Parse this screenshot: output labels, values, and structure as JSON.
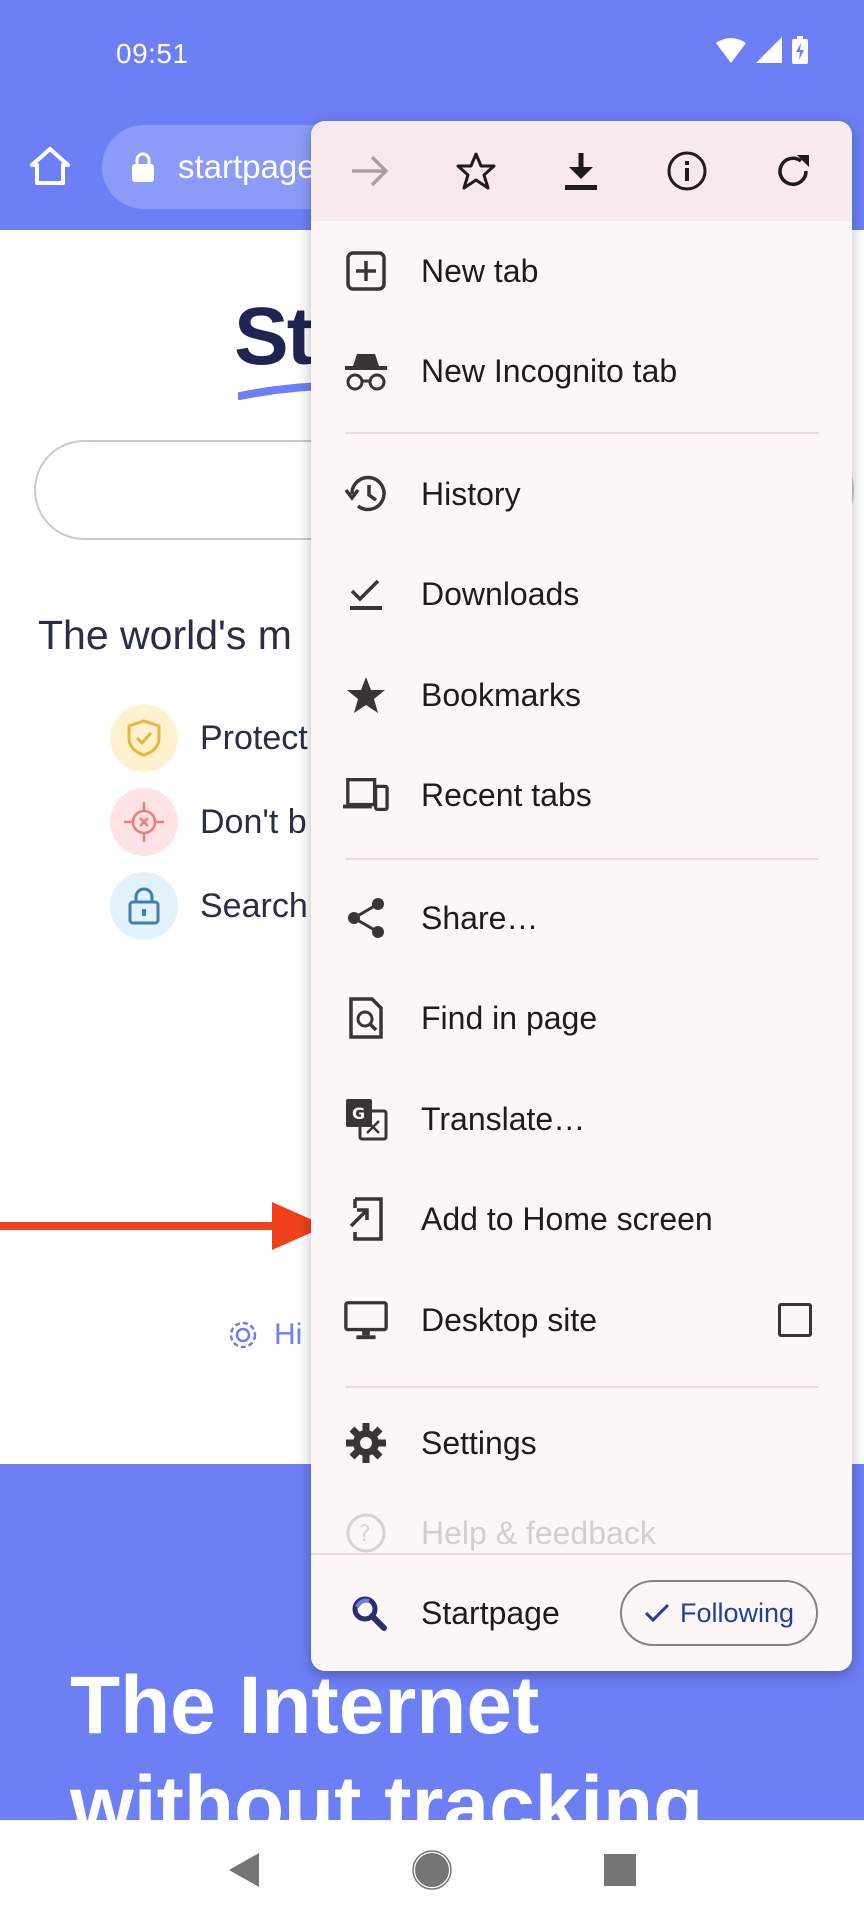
{
  "status_bar": {
    "time": "09:51"
  },
  "toolbar": {
    "url": "startpage"
  },
  "page": {
    "logo": "St",
    "tagline": "The world's m",
    "features": [
      {
        "text": "Protect",
        "icon": "shield-check-icon"
      },
      {
        "text": "Don't b",
        "icon": "crosshair-icon"
      },
      {
        "text": "Search",
        "icon": "lock-icon"
      }
    ],
    "settings_link": "Hi",
    "hero_text": "The Internet without tracking"
  },
  "menu": {
    "top_actions": [
      "forward-icon",
      "star-icon",
      "download-icon",
      "info-icon",
      "reload-icon"
    ],
    "items": [
      {
        "label": "New tab",
        "icon": "new-tab-icon"
      },
      {
        "label": "New Incognito tab",
        "icon": "incognito-icon"
      },
      {
        "label": "History",
        "icon": "history-icon"
      },
      {
        "label": "Downloads",
        "icon": "downloads-icon"
      },
      {
        "label": "Bookmarks",
        "icon": "bookmarks-icon"
      },
      {
        "label": "Recent tabs",
        "icon": "devices-icon"
      },
      {
        "label": "Share…",
        "icon": "share-icon"
      },
      {
        "label": "Find in page",
        "icon": "find-icon"
      },
      {
        "label": "Translate…",
        "icon": "translate-icon"
      },
      {
        "label": "Add to Home screen",
        "icon": "add-home-icon"
      },
      {
        "label": "Desktop site",
        "icon": "monitor-icon"
      },
      {
        "label": "Settings",
        "icon": "settings-icon"
      },
      {
        "label": "Help & feedback",
        "icon": "help-icon"
      }
    ],
    "desktop_site_checked": false,
    "footer": {
      "site": "Startpage",
      "follow_label": "Following"
    }
  },
  "colors": {
    "brand": "#6c7ff5",
    "annotation_arrow": "#f2401c"
  }
}
